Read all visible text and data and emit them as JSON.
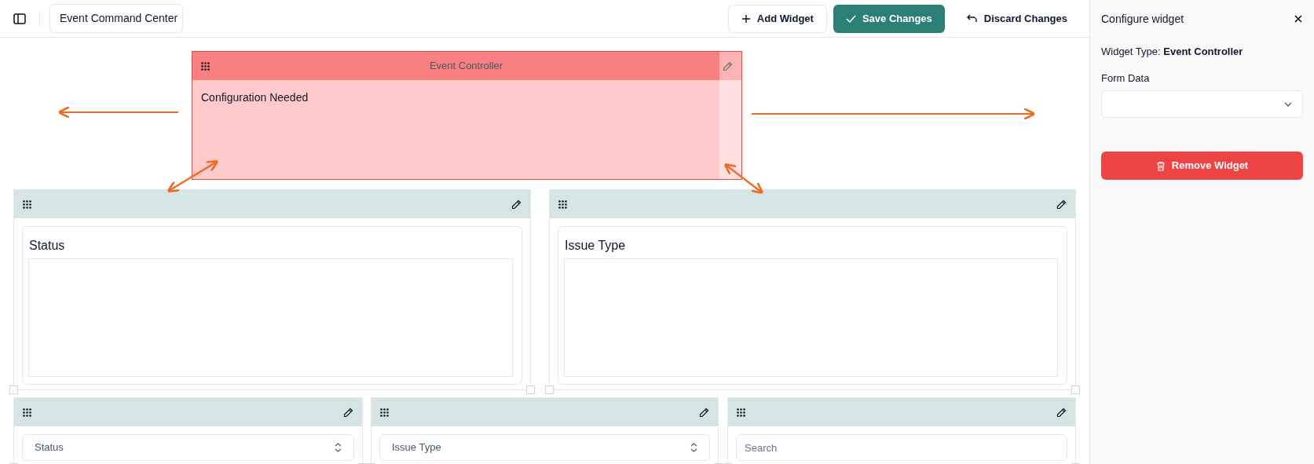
{
  "toolbar": {
    "dashboard_name": "Event Command Center",
    "buttons": [
      {
        "label": "Add Widget",
        "kind": "add"
      },
      {
        "label": "Save Changes",
        "kind": "save"
      },
      {
        "label": "Discard Changes",
        "kind": "discard"
      }
    ]
  },
  "widgets": [
    {
      "kind": "controller",
      "title": "Event Controller",
      "message": "Configuration Needed",
      "selected": true
    },
    {
      "kind": "chart",
      "title": "Status",
      "selected": false
    },
    {
      "kind": "chart",
      "title": "Issue Type",
      "selected": false
    },
    {
      "kind": "select",
      "value": "Status",
      "selected": false
    },
    {
      "kind": "select",
      "value": "Issue Type",
      "selected": false
    },
    {
      "kind": "search",
      "placeholder": "Search",
      "selected": false
    }
  ],
  "panel": {
    "title": "Configure widget",
    "widget_type": "Widget Type: **Event Controller**",
    "form_label": "Form Data",
    "remove_button": "Remove Widget"
  }
}
